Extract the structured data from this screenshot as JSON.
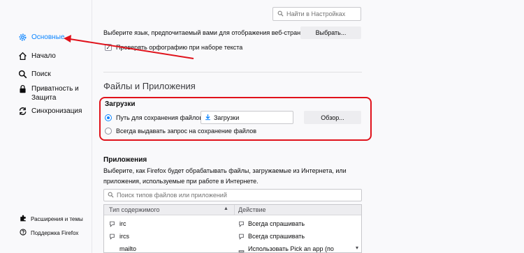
{
  "search": {
    "placeholder": "Найти в Настройках"
  },
  "sidebar": {
    "items": [
      {
        "label": "Основные",
        "icon": "gear-icon",
        "active": true
      },
      {
        "label": "Начало",
        "icon": "home-icon"
      },
      {
        "label": "Поиск",
        "icon": "search-icon"
      },
      {
        "label": "Приватность и Защита",
        "icon": "lock-icon"
      },
      {
        "label": "Синхронизация",
        "icon": "sync-icon"
      }
    ],
    "footer": [
      {
        "label": "Расширения и темы",
        "icon": "puzzle-icon"
      },
      {
        "label": "Поддержка Firefox",
        "icon": "help-icon"
      }
    ]
  },
  "language": {
    "description": "Выберите язык, предпочитаемый вами для отображения веб-страниц",
    "button": "Выбрать..."
  },
  "spellcheck": {
    "label": "Проверять орфографию при наборе текста",
    "checked": true
  },
  "files_section": {
    "title": "Файлы и Приложения"
  },
  "downloads": {
    "title": "Загрузки",
    "save_path_label": "Путь для сохранения файлов",
    "save_path_value": "Загрузки",
    "browse_button": "Обзор...",
    "always_ask_label": "Всегда выдавать запрос на сохранение файлов"
  },
  "applications": {
    "title": "Приложения",
    "description_line1": "Выберите, как Firefox будет обрабатывать файлы, загружаемые из Интернета, или",
    "description_line2": "приложения, используемые при работе в Интернете.",
    "search_placeholder": "Поиск типов файлов или приложений",
    "columns": [
      "Тип содержимого",
      "Действие"
    ],
    "rows": [
      {
        "type": "irc",
        "action": "Всегда спрашивать"
      },
      {
        "type": "ircs",
        "action": "Всегда спрашивать"
      },
      {
        "type": "mailto",
        "action": "Использовать Pick an app (по умолчанию)"
      }
    ]
  },
  "colors": {
    "accent": "#0a84ff",
    "annotation": "#e0121b"
  }
}
